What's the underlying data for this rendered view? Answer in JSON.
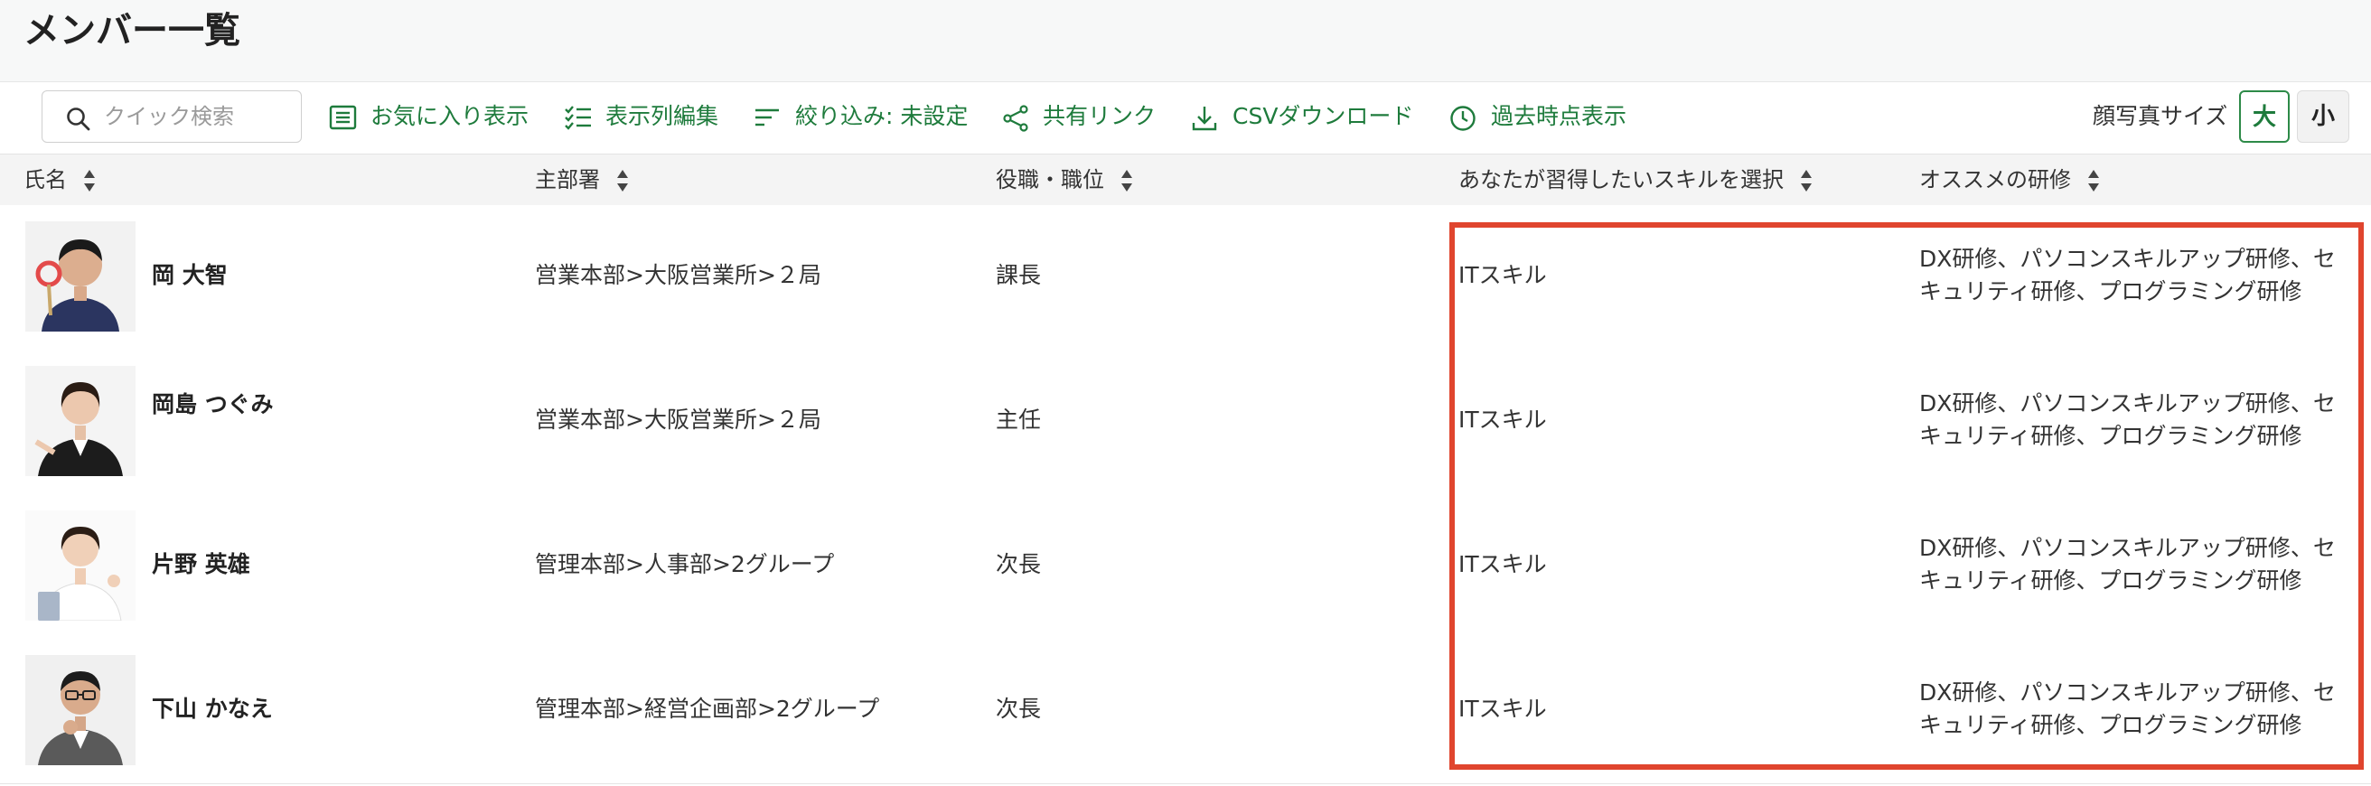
{
  "page": {
    "title": "メンバー一覧"
  },
  "toolbar": {
    "search_placeholder": "クイック検索",
    "favorites": "お気に入り表示",
    "columns": "表示列編集",
    "filter": "絞り込み: 未設定",
    "share": "共有リンク",
    "csv": "CSVダウンロード",
    "history": "過去時点表示",
    "photo_size_label": "顔写真サイズ",
    "size_large": "大",
    "size_small": "小"
  },
  "colors": {
    "accent": "#1e7b3c",
    "highlight": "#e0452e"
  },
  "table": {
    "headers": [
      "氏名",
      "主部署",
      "役職・職位",
      "あなたが習得したいスキルを選択",
      "オススメの研修"
    ],
    "rows": [
      {
        "name": "岡 大智",
        "dept": "営業本部>大阪営業所>２局",
        "role": "課長",
        "skill": "ITスキル",
        "training": "DX研修、パソコンスキルアップ研修、セキュリティ研修、プログラミング研修"
      },
      {
        "name": "岡島 つぐみ",
        "dept": "営業本部>大阪営業所>２局",
        "role": "主任",
        "skill": "ITスキル",
        "training": "DX研修、パソコンスキルアップ研修、セキュリティ研修、プログラミング研修"
      },
      {
        "name": "片野 英雄",
        "dept": "管理本部>人事部>2グループ",
        "role": "次長",
        "skill": "ITスキル",
        "training": "DX研修、パソコンスキルアップ研修、セキュリティ研修、プログラミング研修"
      },
      {
        "name": "下山 かなえ",
        "dept": "管理本部>経営企画部>2グループ",
        "role": "次長",
        "skill": "ITスキル",
        "training": "DX研修、パソコンスキルアップ研修、セキュリティ研修、プログラミング研修"
      }
    ]
  }
}
